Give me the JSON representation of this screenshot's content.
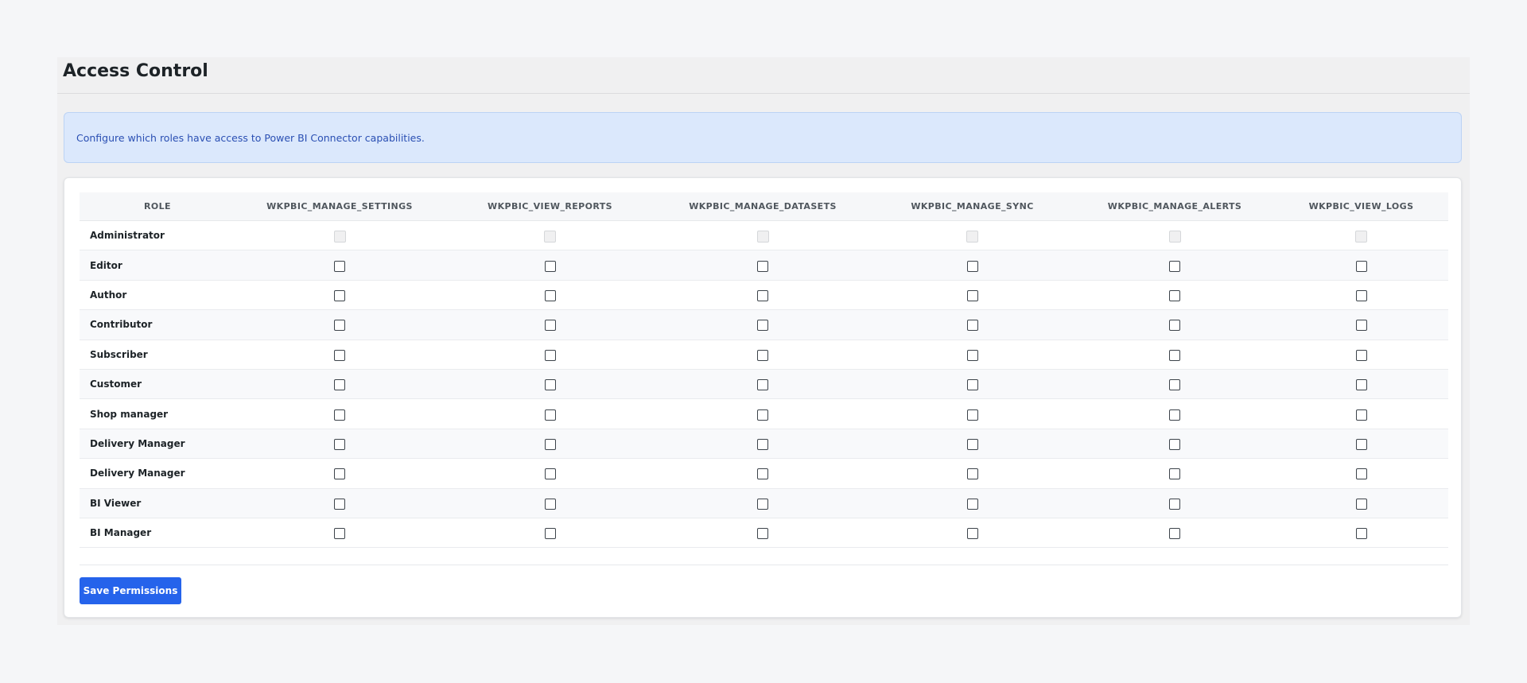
{
  "page": {
    "title": "Access Control"
  },
  "notice": {
    "text": "Configure which roles have access to Power BI Connector capabilities."
  },
  "table": {
    "role_header": "ROLE",
    "capabilities": [
      "WKPBIC_MANAGE_SETTINGS",
      "WKPBIC_VIEW_REPORTS",
      "WKPBIC_MANAGE_DATASETS",
      "WKPBIC_MANAGE_SYNC",
      "WKPBIC_MANAGE_ALERTS",
      "WKPBIC_VIEW_LOGS"
    ],
    "rows": [
      {
        "role": "Administrator",
        "checked": [
          false,
          false,
          false,
          false,
          false,
          false
        ],
        "disabled": true
      },
      {
        "role": "Editor",
        "checked": [
          false,
          false,
          false,
          false,
          false,
          false
        ],
        "disabled": false
      },
      {
        "role": "Author",
        "checked": [
          false,
          false,
          false,
          false,
          false,
          false
        ],
        "disabled": false
      },
      {
        "role": "Contributor",
        "checked": [
          false,
          false,
          false,
          false,
          false,
          false
        ],
        "disabled": false
      },
      {
        "role": "Subscriber",
        "checked": [
          false,
          false,
          false,
          false,
          false,
          false
        ],
        "disabled": false
      },
      {
        "role": "Customer",
        "checked": [
          false,
          false,
          false,
          false,
          false,
          false
        ],
        "disabled": false
      },
      {
        "role": "Shop manager",
        "checked": [
          false,
          false,
          false,
          false,
          false,
          false
        ],
        "disabled": false
      },
      {
        "role": "Delivery Manager",
        "checked": [
          false,
          false,
          false,
          false,
          false,
          false
        ],
        "disabled": false
      },
      {
        "role": "Delivery Manager",
        "checked": [
          false,
          false,
          false,
          false,
          false,
          false
        ],
        "disabled": false
      },
      {
        "role": "BI Viewer",
        "checked": [
          false,
          false,
          false,
          false,
          false,
          false
        ],
        "disabled": false
      },
      {
        "role": "BI Manager",
        "checked": [
          false,
          false,
          false,
          false,
          false,
          false
        ],
        "disabled": false
      }
    ]
  },
  "actions": {
    "save_label": "Save Permissions"
  },
  "colors": {
    "primary_button": "#2563eb",
    "notice_background": "#dbe8fc",
    "notice_text": "#2a4fb3"
  }
}
